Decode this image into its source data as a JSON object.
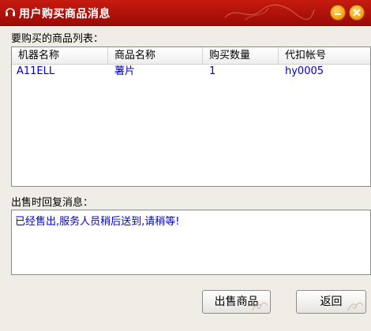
{
  "window": {
    "title": "用户购买商品消息",
    "title_icon": "headset-icon",
    "accent_color": "#b8140b"
  },
  "product_list": {
    "label": "要购买的商品列表：",
    "columns": [
      "机器名称",
      "商品名称",
      "购买数量",
      "代扣帐号"
    ],
    "rows": [
      [
        "A11ELL",
        "薯片",
        "1",
        "hy0005"
      ]
    ]
  },
  "reply": {
    "label": "出售时回复消息：",
    "message": "已经售出,服务人员稍后送到,请稍等!"
  },
  "buttons": {
    "sell_label": "出售商品",
    "back_label": "返回"
  }
}
